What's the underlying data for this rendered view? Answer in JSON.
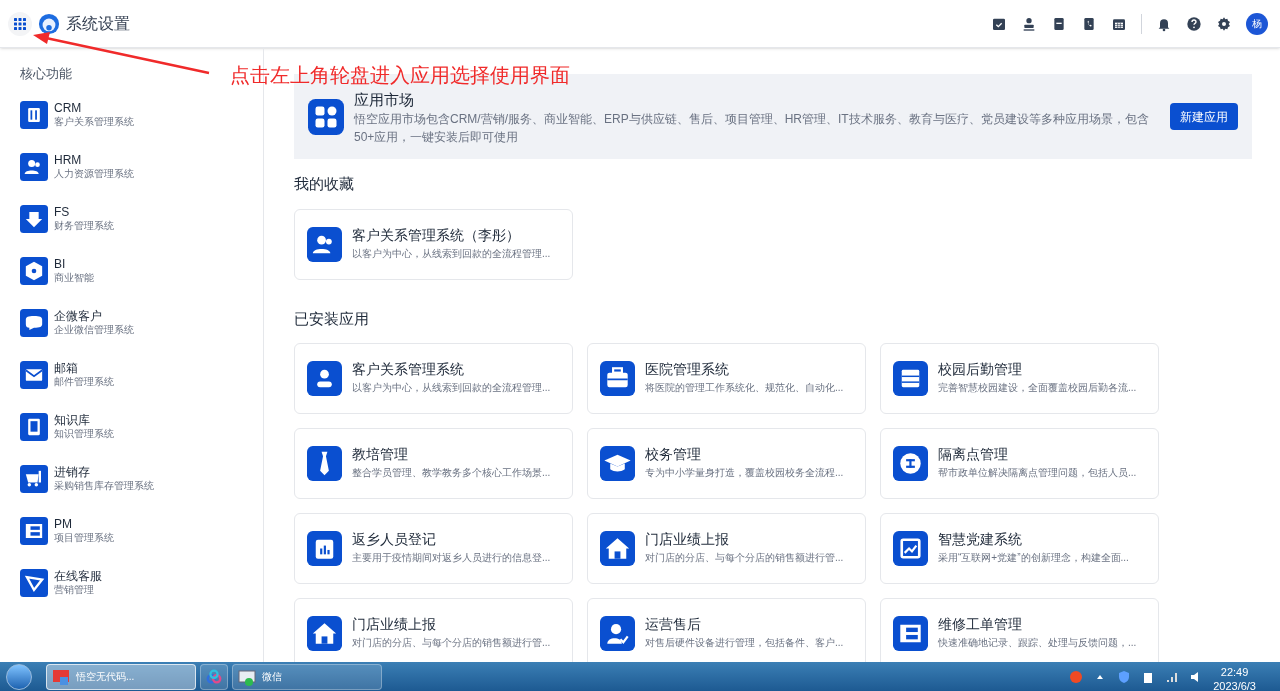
{
  "header": {
    "title": "系统设置",
    "avatar": "杨"
  },
  "annotation": {
    "text": "点击左上角轮盘进入应用选择使用界面"
  },
  "sidebar": {
    "heading": "核心功能",
    "items": [
      {
        "title": "CRM",
        "subtitle": "客户关系管理系统"
      },
      {
        "title": "HRM",
        "subtitle": "人力资源管理系统"
      },
      {
        "title": "FS",
        "subtitle": "财务管理系统"
      },
      {
        "title": "BI",
        "subtitle": "商业智能"
      },
      {
        "title": "企微客户",
        "subtitle": "企业微信管理系统"
      },
      {
        "title": "邮箱",
        "subtitle": "邮件管理系统"
      },
      {
        "title": "知识库",
        "subtitle": "知识管理系统"
      },
      {
        "title": "进销存",
        "subtitle": "采购销售库存管理系统"
      },
      {
        "title": "PM",
        "subtitle": "项目管理系统"
      },
      {
        "title": "在线客服",
        "subtitle": "营销管理"
      }
    ]
  },
  "market": {
    "title": "应用市场",
    "description": "悟空应用市场包含CRM/营销/服务、商业智能、ERP与供应链、售后、项目管理、HR管理、IT技术服务、教育与医疗、党员建设等多种应用场景，包含50+应用，一键安装后即可使用",
    "button": "新建应用"
  },
  "favorites": {
    "heading": "我的收藏",
    "apps": [
      {
        "title": "客户关系管理系统（李彤）",
        "description": "以客户为中心，从线索到回款的全流程管理..."
      }
    ]
  },
  "installed": {
    "heading": "已安装应用",
    "apps": [
      {
        "title": "客户关系管理系统",
        "description": "以客户为中心，从线索到回款的全流程管理..."
      },
      {
        "title": "医院管理系统",
        "description": "将医院的管理工作系统化、规范化、自动化..."
      },
      {
        "title": "校园后勤管理",
        "description": "完善智慧校园建设，全面覆盖校园后勤各流..."
      },
      {
        "title": "教培管理",
        "description": "整合学员管理、教学教务多个核心工作场景..."
      },
      {
        "title": "校务管理",
        "description": "专为中小学量身打造，覆盖校园校务全流程..."
      },
      {
        "title": "隔离点管理",
        "description": "帮市政单位解决隔离点管理问题，包括人员..."
      },
      {
        "title": "返乡人员登记",
        "description": "主要用于疫情期间对返乡人员进行的信息登..."
      },
      {
        "title": "门店业绩上报",
        "description": "对门店的分店、与每个分店的销售额进行管..."
      },
      {
        "title": "智慧党建系统",
        "description": "采用“互联网+党建”的创新理念，构建全面..."
      },
      {
        "title": "门店业绩上报",
        "description": "对门店的分店、与每个分店的销售额进行管..."
      },
      {
        "title": "运营售后",
        "description": "对售后硬件设备进行管理，包括备件、客户..."
      },
      {
        "title": "维修工单管理",
        "description": "快速准确地记录、跟踪、处理与反馈问题，..."
      }
    ]
  },
  "taskbar": {
    "windows": [
      {
        "label": "悟空无代码...",
        "selected": true
      },
      {
        "selected": false
      },
      {
        "label": "微信",
        "selected": false
      }
    ],
    "time": "22:49",
    "date": "2023/6/3"
  }
}
